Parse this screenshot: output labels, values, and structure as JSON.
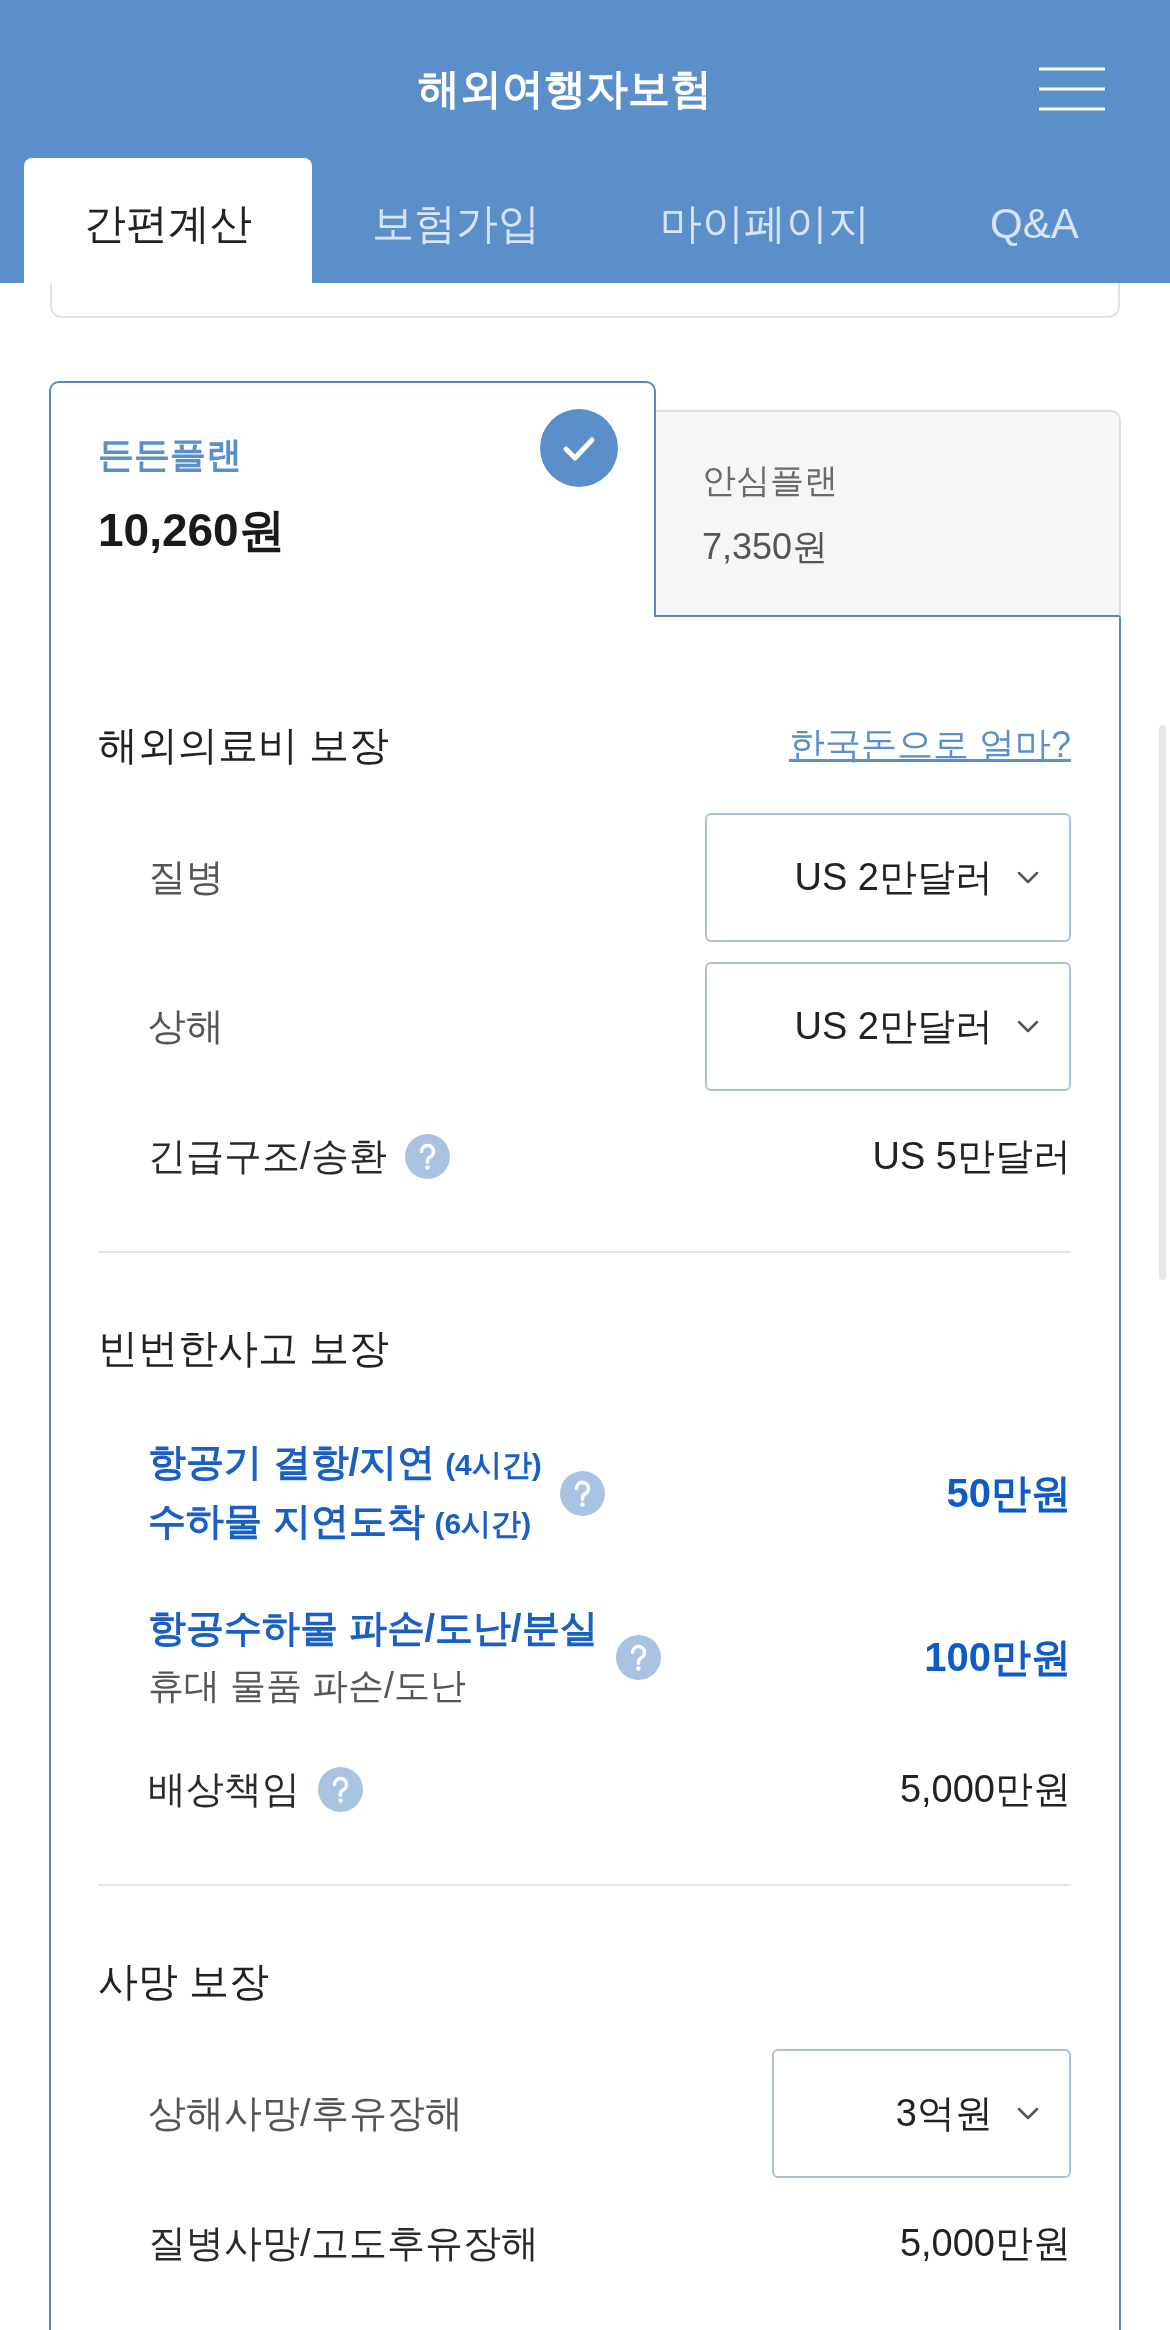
{
  "header": {
    "title": "해외여행자보험"
  },
  "tabs": [
    {
      "label": "간편계산",
      "selected": true
    },
    {
      "label": "보험가입",
      "selected": false
    },
    {
      "label": "마이페이지",
      "selected": false
    },
    {
      "label": "Q&A",
      "selected": false
    }
  ],
  "plans": [
    {
      "name": "든든플랜",
      "price": "10,260원",
      "selected": true
    },
    {
      "name": "안심플랜",
      "price": "7,350원",
      "selected": false
    }
  ],
  "sections": [
    {
      "title": "해외의료비 보장",
      "link": "한국돈으로 얼마?",
      "rows": [
        {
          "kind": "select",
          "label": "질병",
          "value": "US 2만달러",
          "help": false,
          "emphasized": false
        },
        {
          "kind": "select",
          "label": "상해",
          "value": "US 2만달러",
          "help": false,
          "emphasized": false
        },
        {
          "kind": "value",
          "label": "긴급구조/송환",
          "value": "US 5만달러",
          "help": true,
          "emphasized": false
        }
      ]
    },
    {
      "title": "빈번한사고 보장",
      "rows": [
        {
          "kind": "multi",
          "lines": [
            {
              "text": "항공기 결항/지연",
              "note": "(4시간)",
              "emphasized": true
            },
            {
              "text": "수하물 지연도착",
              "note": "(6시간)",
              "emphasized": true
            }
          ],
          "value": "50만원",
          "help": true,
          "emphasized": true
        },
        {
          "kind": "multi",
          "lines": [
            {
              "text": "항공수하물 파손/도난/분실",
              "emphasized": true
            },
            {
              "text": "휴대 물품 파손/도난",
              "emphasized": false
            }
          ],
          "value": "100만원",
          "help": true,
          "emphasized": true
        },
        {
          "kind": "value",
          "label": "배상책임",
          "value": "5,000만원",
          "help": true,
          "emphasized": false
        }
      ]
    },
    {
      "title": "사망 보장",
      "rows": [
        {
          "kind": "select",
          "label": "상해사망/후유장해",
          "value": "3억원",
          "help": false,
          "emphasized": false
        },
        {
          "kind": "value",
          "label": "질병사망/고도후유장해",
          "value": "5,000만원",
          "help": false,
          "emphasized": false
        }
      ]
    }
  ]
}
